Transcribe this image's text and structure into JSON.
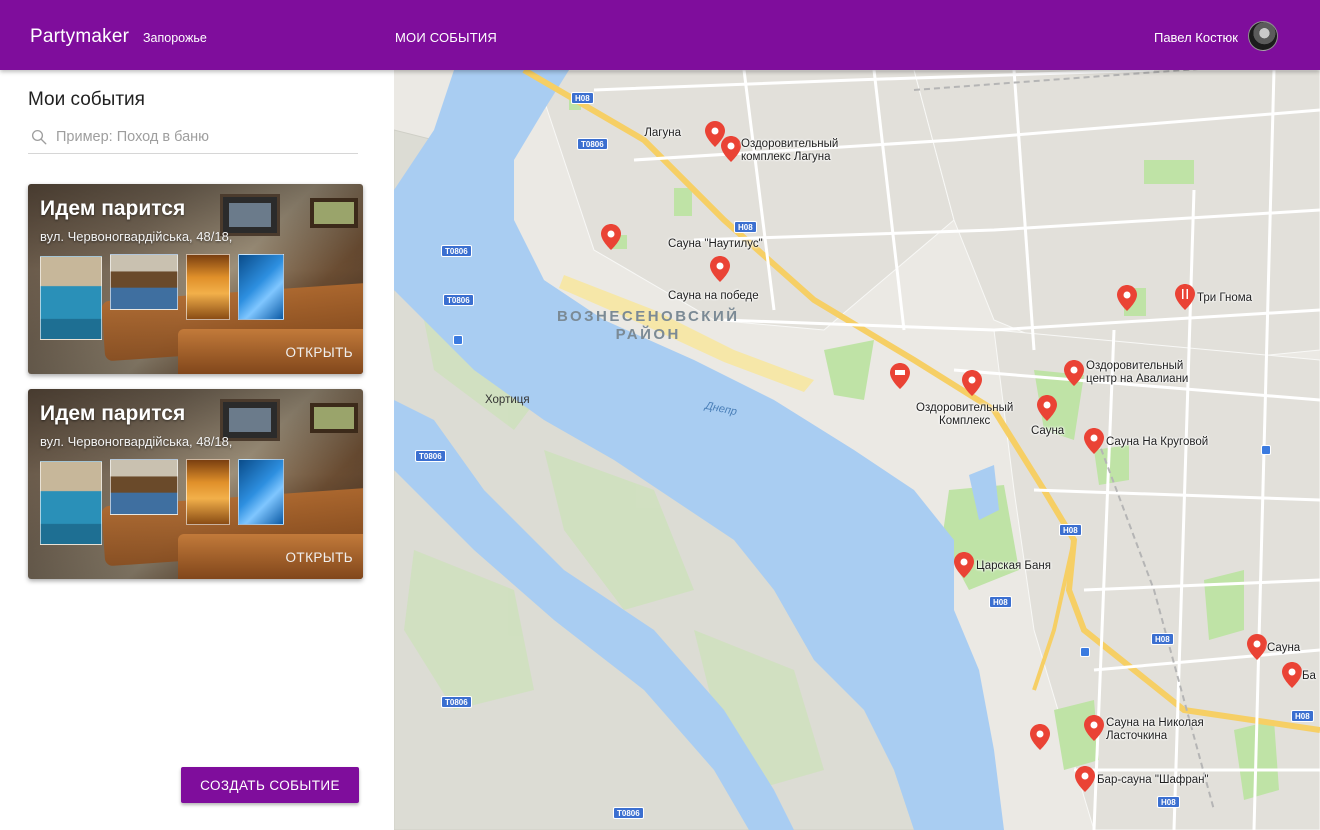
{
  "header": {
    "brand": "Partymaker",
    "city": "Запорожье",
    "nav_my_events": "МОИ СОБЫТИЯ",
    "user_name": "Павел Костюк"
  },
  "sidebar": {
    "title": "Мои события",
    "search_placeholder": "Пример: Поход в баню",
    "events": [
      {
        "title": "Идем парится",
        "address": "вул. Червоногвардійська, 48/18,",
        "action": "ОТКРЫТЬ"
      },
      {
        "title": "Идем парится",
        "address": "вул. Червоногвардійська, 48/18,",
        "action": "ОТКРЫТЬ"
      }
    ],
    "create_button": "СОЗДАТЬ СОБЫТИЕ"
  },
  "map": {
    "district_label": "ВОЗНЕСЕНОВСКИЙ\nРАЙОН",
    "island_label": "Хортиця",
    "river_label": "Днепр",
    "places": [
      {
        "name": "Лагуна"
      },
      {
        "name": "Оздоровительный\nкомплекс Лагуна"
      },
      {
        "name": "Сауна \"Наутилус\""
      },
      {
        "name": "Сауна на победе"
      },
      {
        "name": "Три Гнома"
      },
      {
        "name": "Оздоровительный\nцентр на Авалиани"
      },
      {
        "name": "Оздоровительный\nКомплекс"
      },
      {
        "name": "Сауна"
      },
      {
        "name": "Сауна На Круговой"
      },
      {
        "name": "Царская Баня"
      },
      {
        "name": "Сауна"
      },
      {
        "name": "Ба"
      },
      {
        "name": "Сауна на Николая\nЛасточкина"
      },
      {
        "name": "Бар-сауна \"Шафран\""
      }
    ],
    "road_shields": [
      "H08",
      "T0806",
      "T0806",
      "T0806",
      "H08",
      "T0806",
      "H08",
      "H08",
      "H08",
      "H08",
      "T0806",
      "T0806",
      "H08"
    ]
  }
}
